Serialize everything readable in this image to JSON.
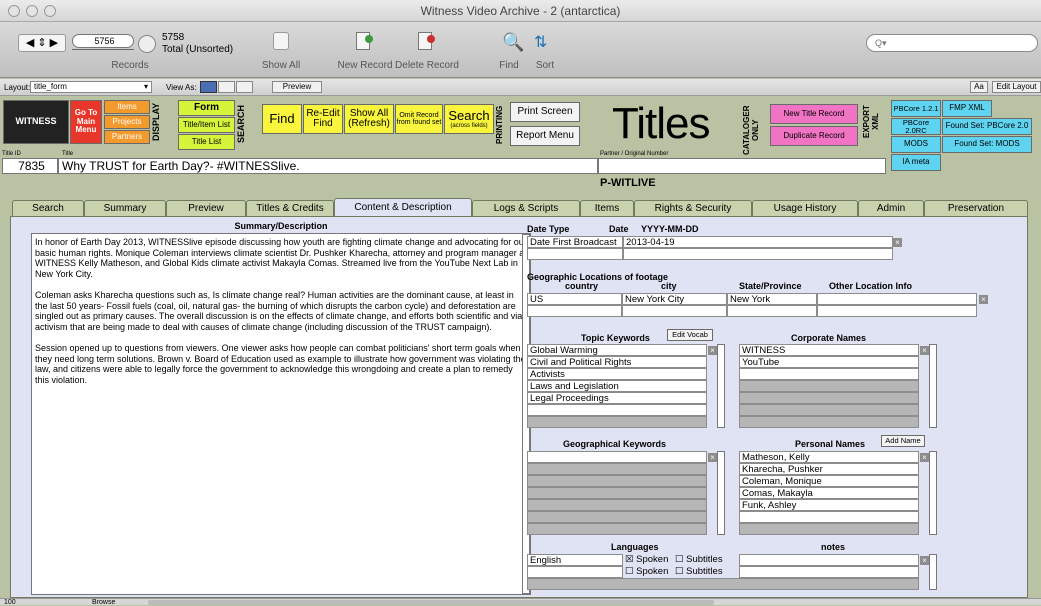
{
  "window": {
    "title": "Witness Video Archive - 2 (antarctica)"
  },
  "toolbar": {
    "record_field": "5756",
    "records_label": "Records",
    "found_count": "5758",
    "total_label": "Total (Unsorted)",
    "show_all": "Show All",
    "new_record": "New Record",
    "delete_record": "Delete Record",
    "find": "Find",
    "sort": "Sort",
    "search_placeholder": "Q▾"
  },
  "layoutbar": {
    "layout_label": "Layout:",
    "layout_value": "title_form",
    "view_as": "View As:",
    "preview": "Preview",
    "aa": "Aa",
    "edit_layout": "Edit Layout"
  },
  "header": {
    "witness_logo": "WITNESS",
    "go_main": "Go To Main Menu",
    "items": "Items",
    "projects": "Projects",
    "partners": "Partners",
    "display": "DISPLAY",
    "form": "Form",
    "title_item_list": "Title/Item List",
    "title_list": "Title List",
    "search_vert": "SEARCH",
    "find": "Find",
    "re_edit_find": "Re-Edit Find",
    "show_all_refresh": "Show All (Refresh)",
    "omit_record": "Omit Record from found set",
    "search_btn": "Search",
    "search_sub": "(across fields)",
    "printing": "PRINTING",
    "print_screen": "Print Screen",
    "report_menu": "Report Menu",
    "titles": "Titles",
    "cataloger_only": "CATALOGER ONLY",
    "new_title_record": "New Title Record",
    "duplicate_record": "Duplicate Record",
    "export_xml": "EXPORT XML",
    "pbcore_121": "PBCore 1.2.1",
    "pbcore_20rc": "PBCore 2.0RC",
    "mods": "MODS",
    "ia_meta": "IA meta",
    "fmp_xml": "FMP XML",
    "found_pbcore": "Found Set: PBCore 2.0",
    "found_mods": "Found Set: MODS",
    "title_id_label": "Title ID",
    "title_label": "Title",
    "title_id": "7835",
    "title_value": "Why TRUST for Earth Day?- #WITNESSlive.",
    "partner_label": "Partner / Original Number",
    "partner_value": "",
    "partner_code": "P-WITLIVE"
  },
  "tabs": [
    "Search",
    "Summary",
    "Preview",
    "Titles & Credits",
    "Content & Description",
    "Logs & Scripts",
    "Items",
    "Rights & Security",
    "Usage History",
    "Admin",
    "Preservation"
  ],
  "content": {
    "summary_title": "Summary/Description",
    "summary_p1": "In honor of Earth Day 2013, WITNESSlive episode discussing how youth are fighting climate change and advocating for our basic human rights. Monique Coleman interviews climate scientist Dr. Pushker Kharecha, attorney and program manager at WITNESS Kelly Matheson, and Global Kids climate activist Makayla Comas. Streamed live from the YouTube Next Lab in New York City.",
    "summary_p2": "Coleman asks Kharecha questions such as, Is climate change real? Human activities are the dominant cause, at least in the last 50 years- Fossil fuels (coal, oil, natural gas- the burning of which disrupts the carbon cycle) and deforestation are singled out as primary causes. The overall discussion is on the effects of climate change, and efforts both scientific and via activism that are being made to deal with causes of climate change (including discussion of the TRUST campaign).",
    "summary_p3": "Session opened up to questions from viewers. One viewer asks how people can combat politicians' short term goals when they need long term solutions. Brown v. Board of Education used as example to illustrate how government was violating the law, and citizens were able to legally force the government to acknowledge this wrongdoing and create a plan to remedy this violation.",
    "date_type_label": "Date Type",
    "date_label": "Date",
    "date_format": "YYYY-MM-DD",
    "date_type": "Date First Broadcast",
    "date_value": "2013-04-19",
    "geo_title": "Geographic Locations of footage",
    "country_label": "country",
    "city_label": "city",
    "state_label": "State/Province",
    "other_label": "Other Location Info",
    "country": "US",
    "city": "New York City",
    "state": "New York",
    "topic_title": "Topic Keywords",
    "edit_vocab": "Edit Vocab",
    "topics": [
      "Global Warming",
      "Civil and Political Rights",
      "Activists",
      "Laws and Legislation",
      "Legal Proceedings"
    ],
    "corp_title": "Corporate Names",
    "corps": [
      "WITNESS",
      "YouTube"
    ],
    "geo_kw_title": "Geographical Keywords",
    "personal_title": "Personal Names",
    "add_name": "Add Name",
    "persons": [
      "Matheson, Kelly",
      "Kharecha, Pushker",
      "Coleman, Monique",
      "Comas, Makayla",
      "Funk, Ashley"
    ],
    "languages_title": "Languages",
    "language": "English",
    "spoken": "Spoken",
    "subtitles": "Subtitles",
    "notes_title": "notes"
  },
  "status": {
    "zoom": "100",
    "mode": "Browse"
  }
}
